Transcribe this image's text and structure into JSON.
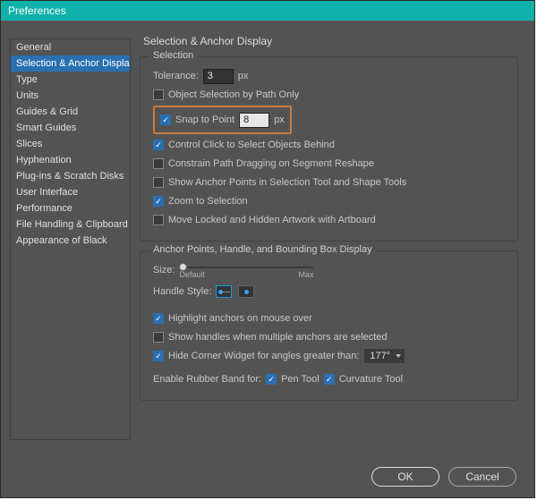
{
  "window": {
    "title": "Preferences"
  },
  "sidebar": {
    "items": [
      {
        "label": "General"
      },
      {
        "label": "Selection & Anchor Display",
        "selected": true
      },
      {
        "label": "Type"
      },
      {
        "label": "Units"
      },
      {
        "label": "Guides & Grid"
      },
      {
        "label": "Smart Guides"
      },
      {
        "label": "Slices"
      },
      {
        "label": "Hyphenation"
      },
      {
        "label": "Plug-ins & Scratch Disks"
      },
      {
        "label": "User Interface"
      },
      {
        "label": "Performance"
      },
      {
        "label": "File Handling & Clipboard"
      },
      {
        "label": "Appearance of Black"
      }
    ]
  },
  "pane": {
    "title": "Selection & Anchor Display",
    "selection": {
      "legend": "Selection",
      "tolerance_label": "Tolerance:",
      "tolerance_value": "3",
      "tolerance_unit": "px",
      "object_selection_path_only": {
        "label": "Object Selection by Path Only",
        "checked": false
      },
      "snap_to_point": {
        "label": "Snap to Point",
        "checked": true,
        "value": "8",
        "unit": "px"
      },
      "control_click_behind": {
        "label": "Control Click to Select Objects Behind",
        "checked": true
      },
      "constrain_path_drag": {
        "label": "Constrain Path Dragging on Segment Reshape",
        "checked": false
      },
      "show_anchor_in_tools": {
        "label": "Show Anchor Points in Selection Tool and Shape Tools",
        "checked": false
      },
      "zoom_to_selection": {
        "label": "Zoom to Selection",
        "checked": true
      },
      "move_locked_with_artboard": {
        "label": "Move Locked and Hidden Artwork with Artboard",
        "checked": false
      }
    },
    "anchor": {
      "legend": "Anchor Points, Handle, and Bounding Box Display",
      "size_label": "Size:",
      "size_min": "Default",
      "size_max": "Max",
      "handle_style_label": "Handle Style:",
      "highlight_hover": {
        "label": "Highlight anchors on mouse over",
        "checked": true
      },
      "show_handles_multi": {
        "label": "Show handles when multiple anchors are selected",
        "checked": false
      },
      "hide_corner_widget": {
        "label": "Hide Corner Widget for angles greater than:",
        "checked": true,
        "value": "177°"
      },
      "rubber_band_label": "Enable Rubber Band for:",
      "rubber_pen": {
        "label": "Pen Tool",
        "checked": true
      },
      "rubber_curv": {
        "label": "Curvature Tool",
        "checked": true
      }
    }
  },
  "footer": {
    "ok": "OK",
    "cancel": "Cancel"
  }
}
